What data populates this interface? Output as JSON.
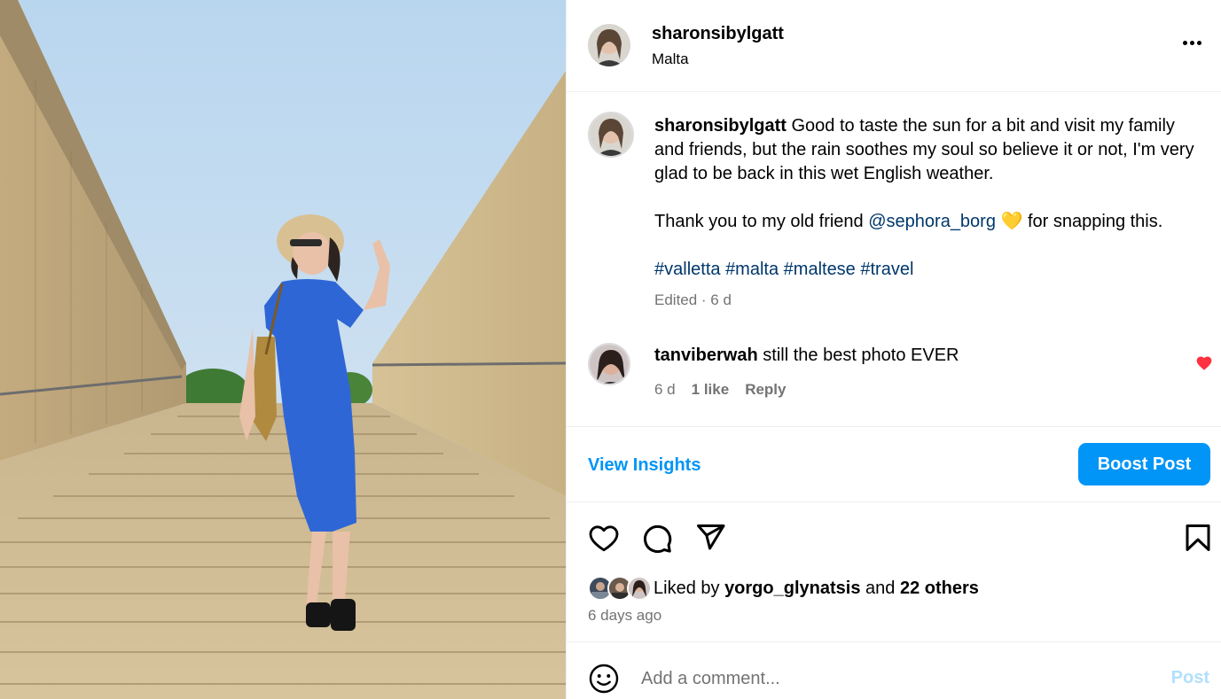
{
  "post": {
    "username": "sharonsibylgatt",
    "location": "Malta",
    "more_icon": "more-horizontal-icon"
  },
  "caption": {
    "username": "sharonsibylgatt",
    "line1": "Good to taste the sun for a bit and visit my family and friends, but the rain soothes my soul so believe it or not, I'm very glad to be back in this wet English weather.",
    "line2_prefix": "Thank you to my old friend ",
    "mention": "@sephora_borg",
    "emoji": "💛",
    "line2_suffix": " for snapping this.",
    "hashtags": [
      "#valletta",
      "#malta",
      "#maltese",
      "#travel"
    ],
    "meta": "Edited · 6 d"
  },
  "comment": {
    "username": "tanviberwah",
    "text": "still the best photo EVER",
    "time": "6 d",
    "likes": "1 like",
    "reply": "Reply",
    "liked_color": "#ff3040"
  },
  "insights": {
    "view_label": "View Insights",
    "boost_label": "Boost Post",
    "accent": "#0095f6"
  },
  "actions": {
    "icons": [
      "heart-icon",
      "comment-icon",
      "share-icon",
      "bookmark-icon"
    ]
  },
  "likes": {
    "prefix": "Liked by ",
    "user": "yorgo_glynatsis",
    "middle": " and ",
    "others": "22 others",
    "time": "6 days ago"
  },
  "composer": {
    "placeholder": "Add a comment...",
    "post_label": "Post"
  }
}
